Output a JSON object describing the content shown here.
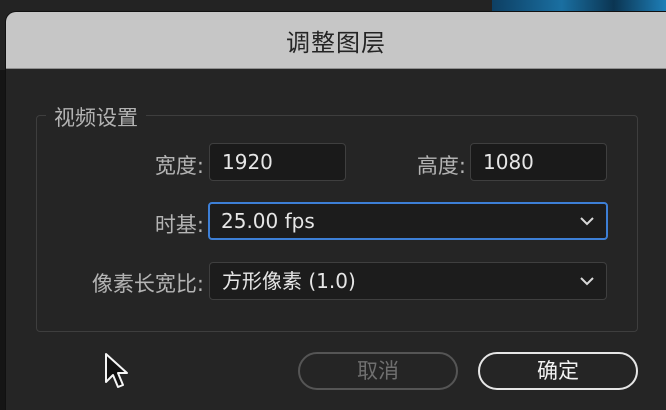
{
  "dialog": {
    "title": "调整图层"
  },
  "video_settings": {
    "legend": "视频设置",
    "width_label": "宽度:",
    "width_value": "1920",
    "height_label": "高度:",
    "height_value": "1080",
    "timebase_label": "时基:",
    "timebase_value": "25.00 fps",
    "pixel_aspect_label": "像素长宽比:",
    "pixel_aspect_value": "方形像素 (1.0)"
  },
  "buttons": {
    "cancel_label": "取消",
    "ok_label": "确定"
  },
  "colors": {
    "focus_accent": "#3d7fd6",
    "titlebar": "#c6c6c6",
    "dialog_bg": "#252525"
  },
  "icons": {
    "dropdown": "chevron-down-icon",
    "pointer": "mouse-cursor-icon"
  }
}
